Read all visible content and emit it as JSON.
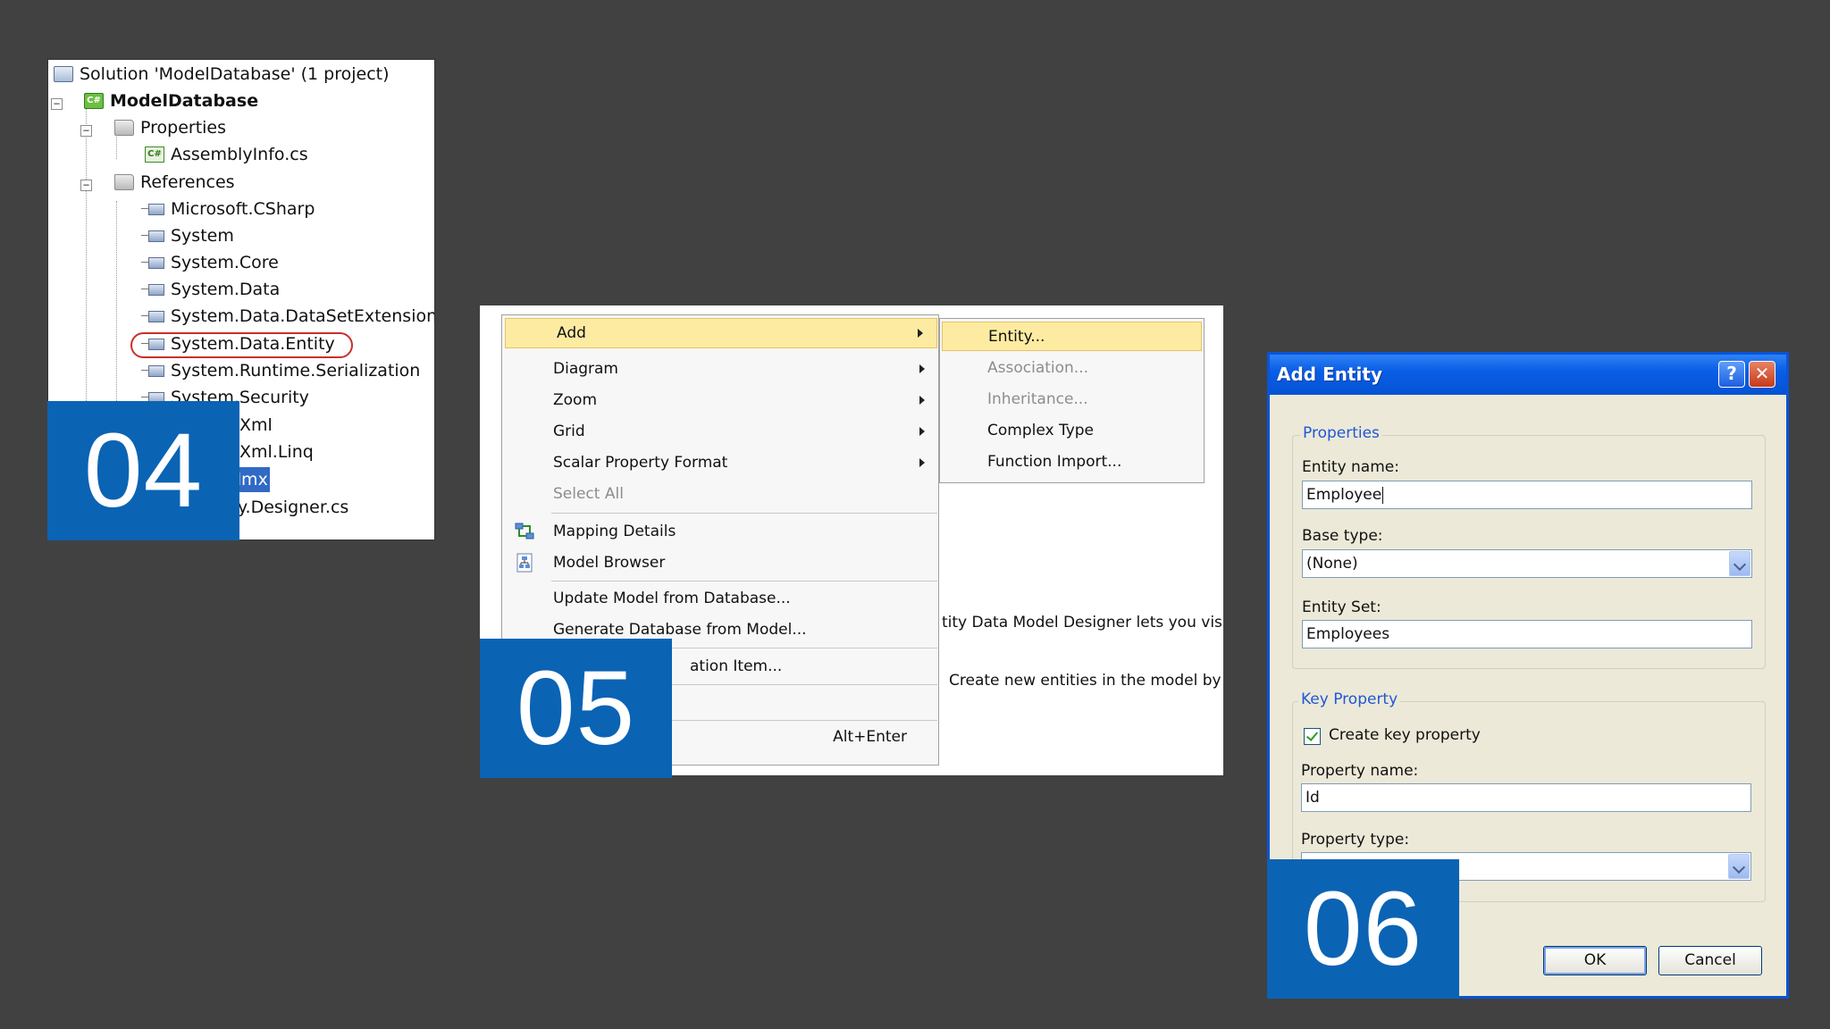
{
  "solution_explorer": {
    "solution_label": "Solution 'ModelDatabase' (1 project)",
    "project_label": "ModelDatabase",
    "properties_folder": "Properties",
    "assemblyinfo_file": "AssemblyInfo.cs",
    "references_folder": "References",
    "references": [
      "Microsoft.CSharp",
      "System",
      "System.Core",
      "System.Data",
      "System.Data.DataSetExtensions",
      "System.Data.Entity",
      "System.Runtime.Serialization",
      "System.Security",
      "Xml",
      "Xml.Linq"
    ],
    "selected_partial": "dmx",
    "designer_partial": "y.Designer.cs"
  },
  "badges": {
    "step4": "04",
    "step5": "05",
    "step6": "06"
  },
  "context_menu": {
    "items": [
      {
        "label": "Add",
        "submenu": true,
        "state": "hover"
      },
      {
        "label": "Diagram",
        "submenu": true
      },
      {
        "label": "Zoom",
        "submenu": true
      },
      {
        "label": "Grid",
        "submenu": true
      },
      {
        "label": "Scalar Property Format",
        "submenu": true
      },
      {
        "label": "Select All",
        "state": "disabled"
      },
      {
        "label": "Mapping Details",
        "icon": "mapping-details-icon"
      },
      {
        "label": "Model Browser",
        "icon": "model-browser-icon"
      },
      {
        "label": "Update Model from Database..."
      },
      {
        "label": "Generate Database from Model..."
      },
      {
        "label": "ation Item..."
      }
    ],
    "properties_shortcut": "Alt+Enter",
    "submenu": [
      {
        "label": "Entity...",
        "state": "hover"
      },
      {
        "label": "Association...",
        "state": "disabled"
      },
      {
        "label": "Inheritance...",
        "state": "disabled"
      },
      {
        "label": "Complex Type"
      },
      {
        "label": "Function Import..."
      }
    ],
    "background_text_1": "tity Data Model Designer lets you visualiz",
    "background_text_2": "Create new entities in the model by drag"
  },
  "dialog": {
    "title": "Add Entity",
    "help_glyph": "?",
    "close_glyph": "✕",
    "properties_group": "Properties",
    "entity_name_label": "Entity name:",
    "entity_name_value": "Employee",
    "base_type_label": "Base type:",
    "base_type_value": "(None)",
    "entity_set_label": "Entity Set:",
    "entity_set_value": "Employees",
    "key_group": "Key Property",
    "create_key_label": "Create key property",
    "create_key_checked": true,
    "property_name_label": "Property name:",
    "property_name_value": "Id",
    "property_type_label": "Property type:",
    "ok_label": "OK",
    "cancel_label": "Cancel"
  },
  "colors": {
    "background": "#414141",
    "badge_blue": "#0b63b4",
    "menu_hover": "#fdeba2",
    "xp_title_blue": "#0453d4",
    "highlight_red": "#c9302c"
  }
}
